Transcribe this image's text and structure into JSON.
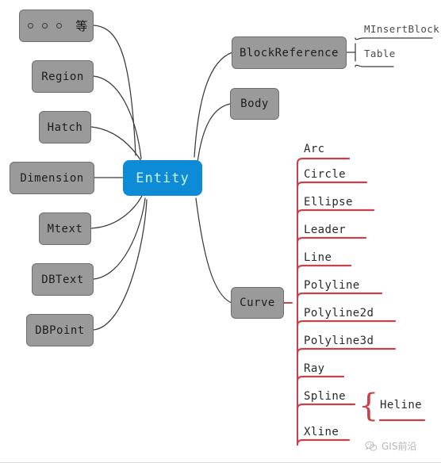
{
  "diagram": {
    "title": "Entity class hierarchy mind map",
    "colors": {
      "center_fill": "#0d8bd6",
      "center_text": "#cdf3ff",
      "node_fill": "#9a9a9a",
      "node_border": "#6e6e6e",
      "connector_gray": "#3a3a3a",
      "connector_red": "#c8414b",
      "background": "#ffffff"
    },
    "center": {
      "label": "Entity"
    },
    "left_nodes": [
      {
        "label": "",
        "kind": "dots",
        "deng": "等"
      },
      {
        "label": "Region",
        "kind": "text"
      },
      {
        "label": "Hatch",
        "kind": "text"
      },
      {
        "label": "Dimension",
        "kind": "text"
      },
      {
        "label": "Mtext",
        "kind": "text"
      },
      {
        "label": "DBText",
        "kind": "text"
      },
      {
        "label": "DBPoint",
        "kind": "text"
      }
    ],
    "right_nodes": [
      {
        "label": "BlockReference"
      },
      {
        "label": "Body"
      },
      {
        "label": "Curve"
      }
    ],
    "block_reference_children": [
      {
        "label": "MInsertBlock"
      },
      {
        "label": "Table"
      }
    ],
    "curve_children": [
      {
        "label": "Arc"
      },
      {
        "label": "Circle"
      },
      {
        "label": "Ellipse"
      },
      {
        "label": "Leader"
      },
      {
        "label": "Line"
      },
      {
        "label": "Polyline"
      },
      {
        "label": "Polyline2d"
      },
      {
        "label": "Polyline3d"
      },
      {
        "label": "Ray"
      },
      {
        "label": "Spline"
      },
      {
        "label": "Xline"
      }
    ],
    "spline_children": [
      {
        "label": "Heline"
      }
    ]
  },
  "watermark": {
    "text": "GIS前沿",
    "icon": "wechat-icon"
  }
}
